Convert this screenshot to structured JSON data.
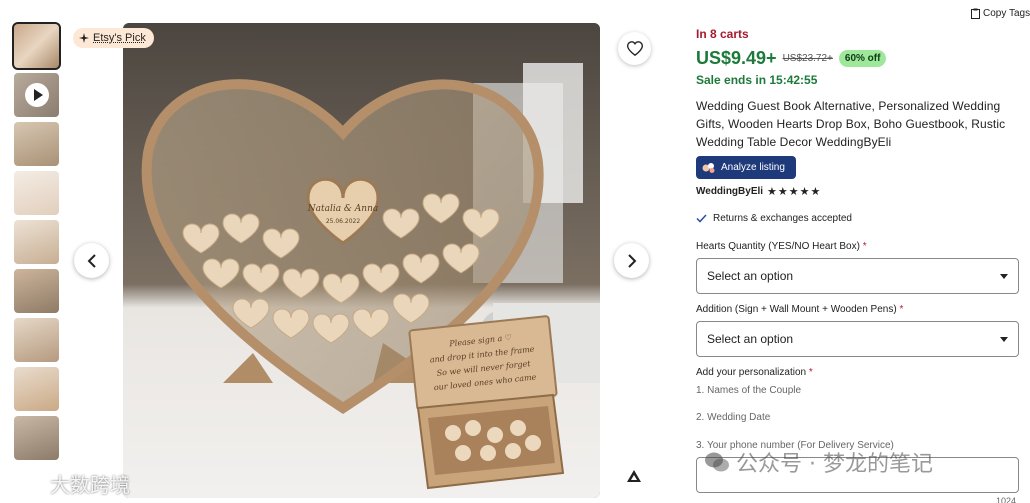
{
  "listing": {
    "badge": "Etsy's Pick",
    "in_carts": "In 8 carts",
    "price": "US$9.49+",
    "original_price": "US$23.72+",
    "discount": "60% off",
    "sale_ends": "Sale ends in 15:42:55",
    "title": "Wedding Guest Book Alternative, Personalized Wedding Gifts, Wooden Hearts Drop Box, Boho Guestbook, Rustic Wedding Table Decor WeddingByEli",
    "analyze_label": "Analyze listing",
    "shop_name": "WeddingByEli",
    "stars": "★★★★★",
    "returns": "Returns & exchanges accepted",
    "copy_tags": "Copy Tags"
  },
  "options": {
    "hearts_label": "Hearts Quantity (YES/NO Heart Box)",
    "hearts_value": "Select an option",
    "addition_label": "Addition (Sign + Wall Mount + Wooden Pens)",
    "addition_value": "Select an option",
    "personalization_label": "Add your personalization",
    "hint1": "1. Names of the Couple",
    "hint2": "2. Wedding Date",
    "hint3": "3. Your phone number (For Delivery Service)",
    "char_count": "1024"
  },
  "image_text": {
    "names": "Natalia & Anna",
    "date": "25.06.2022",
    "sign_line1": "Please sign a ♡",
    "sign_line2": "and drop it into the frame",
    "sign_line3": "So we will never forget",
    "sign_line4": "our loved ones who came"
  },
  "watermarks": {
    "right": "公众号 · 梦龙的笔记",
    "left": "大数跨境"
  },
  "colors": {
    "accent_red": "#a61a2e",
    "price_green": "#1d7a3a",
    "discount_bg": "#9fe89b",
    "analyze_bg": "#1e3a7b"
  },
  "icons": [
    "sparkle-icon",
    "play-icon",
    "heart-outline-icon",
    "chevron-left-icon",
    "chevron-right-icon",
    "triangle-logo-icon",
    "clipboard-icon",
    "checkmark-icon",
    "dropdown-caret-icon"
  ]
}
